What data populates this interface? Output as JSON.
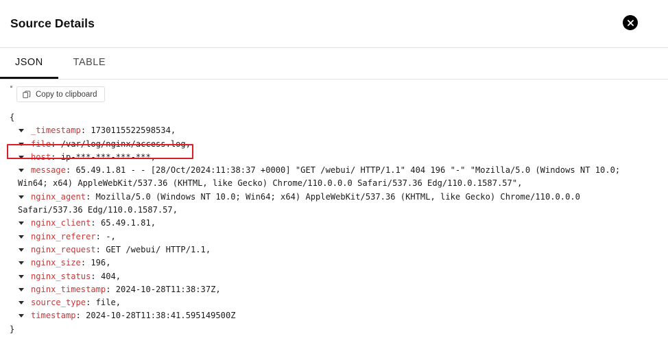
{
  "header": {
    "title": "Source Details",
    "close_label": "Close"
  },
  "tabs": [
    {
      "label": "JSON",
      "active": true
    },
    {
      "label": "TABLE",
      "active": false
    }
  ],
  "toolbar": {
    "copy_label": "Copy to clipboard"
  },
  "json_viewer": {
    "open_brace": "{",
    "close_brace": "}",
    "rows": [
      {
        "key": "_timestamp",
        "value": "1730115522598534,",
        "highlighted": false
      },
      {
        "key": "file",
        "value": "/var/log/nginx/access.log,",
        "highlighted": false
      },
      {
        "key": "host",
        "value": "ip-***-***-***-***,",
        "highlighted": true
      },
      {
        "key": "message",
        "value": "65.49.1.81 - - [28/Oct/2024:11:38:37 +0000] \"GET /webui/ HTTP/1.1\" 404 196 \"-\" \"Mozilla/5.0 (Windows NT 10.0; Win64; x64) AppleWebKit/537.36 (KHTML, like Gecko) Chrome/110.0.0.0 Safari/537.36 Edg/110.0.1587.57\",",
        "highlighted": false
      },
      {
        "key": "nginx_agent",
        "value": "Mozilla/5.0 (Windows NT 10.0; Win64; x64) AppleWebKit/537.36 (KHTML, like Gecko) Chrome/110.0.0.0 Safari/537.36 Edg/110.0.1587.57,",
        "highlighted": false
      },
      {
        "key": "nginx_client",
        "value": "65.49.1.81,",
        "highlighted": false
      },
      {
        "key": "nginx_referer",
        "value": "-,",
        "highlighted": false
      },
      {
        "key": "nginx_request",
        "value": "GET /webui/ HTTP/1.1,",
        "highlighted": false
      },
      {
        "key": "nginx_size",
        "value": "196,",
        "highlighted": false
      },
      {
        "key": "nginx_status",
        "value": "404,",
        "highlighted": false
      },
      {
        "key": "nginx_timestamp",
        "value": "2024-10-28T11:38:37Z,",
        "highlighted": false
      },
      {
        "key": "source_type",
        "value": "file,",
        "highlighted": false
      },
      {
        "key": "timestamp",
        "value": "2024-10-28T11:38:41.595149500Z",
        "highlighted": false
      }
    ]
  },
  "colors": {
    "key": "#c3393a",
    "highlight": "#d81f26",
    "accent": "#111111",
    "divider": "#e4e4e4"
  }
}
